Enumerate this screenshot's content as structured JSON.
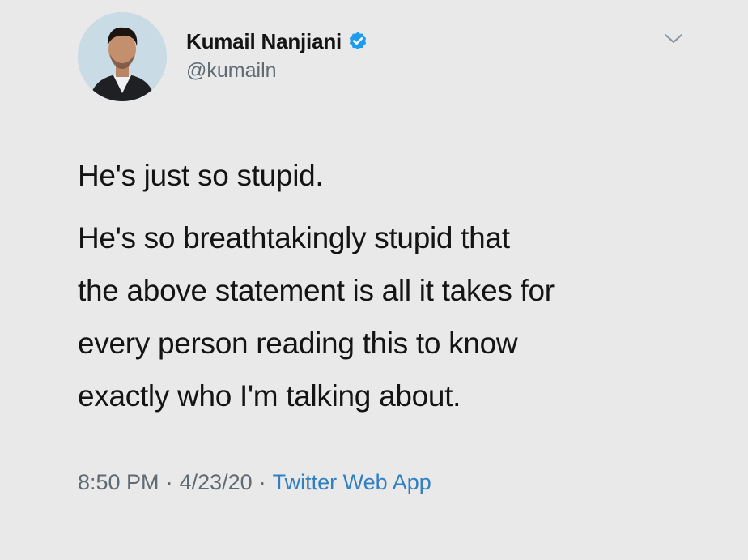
{
  "author": {
    "name": "Kumail Nanjiani",
    "handle": "@kumailn",
    "verified": true
  },
  "tweet": {
    "paragraphs": [
      "He's just so stupid.",
      "He's so breathtakingly stupid that the above statement is all it takes for every person reading this to know exactly who I'm talking about."
    ],
    "lines": [
      "He's so breathtakingly stupid that",
      "the above statement is all it takes for",
      "every person reading this to know",
      "exactly who I'm talking about."
    ],
    "time": "8:50 PM",
    "date": "4/23/20",
    "separator": "·",
    "source": "Twitter Web App"
  },
  "icons": {
    "verified": "verified-badge-icon",
    "menu": "chevron-down-icon"
  },
  "colors": {
    "background": "#e9e9ea",
    "text": "#141414",
    "secondary_text": "#5f6a73",
    "link": "#2f7fc1",
    "verified_badge": "#1d9bf0"
  }
}
